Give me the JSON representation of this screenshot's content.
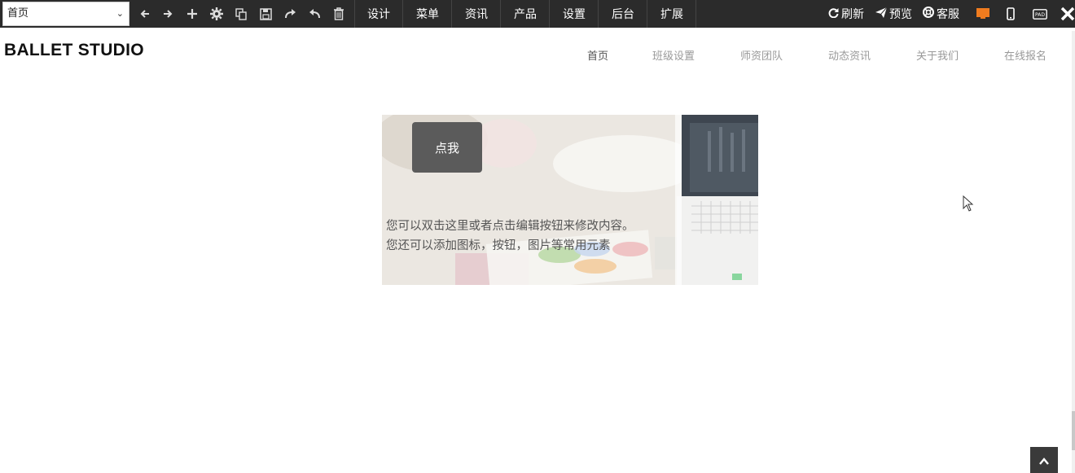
{
  "toolbar": {
    "page_select": {
      "value": "首页"
    },
    "tools": [
      {
        "name": "back-arrow-icon"
      },
      {
        "name": "forward-arrow-icon"
      },
      {
        "name": "plus-icon"
      },
      {
        "name": "gear-icon"
      },
      {
        "name": "copy-icon"
      },
      {
        "name": "save-icon"
      },
      {
        "name": "redo-icon"
      },
      {
        "name": "undo-icon"
      },
      {
        "name": "trash-icon"
      }
    ],
    "menu": [
      "设计",
      "菜单",
      "资讯",
      "产品",
      "设置",
      "后台",
      "扩展"
    ],
    "right": {
      "refresh": "刷新",
      "preview": "预览",
      "service": "客服"
    },
    "colors": {
      "background": "#2b2b2b",
      "desktop_accent": "#f07c1f"
    }
  },
  "site": {
    "logo": "BALLET STUDIO",
    "nav": [
      "首页",
      "班级设置",
      "师资团队",
      "动态资讯",
      "关于我们",
      "在线报名"
    ],
    "active_nav": "首页"
  },
  "banner": {
    "button_label": "点我",
    "text_line1": "您可以双击这里或者点击编辑按钮来修改内容。",
    "text_line2": "您还可以添加图标，按钮，图片等常用元素"
  }
}
